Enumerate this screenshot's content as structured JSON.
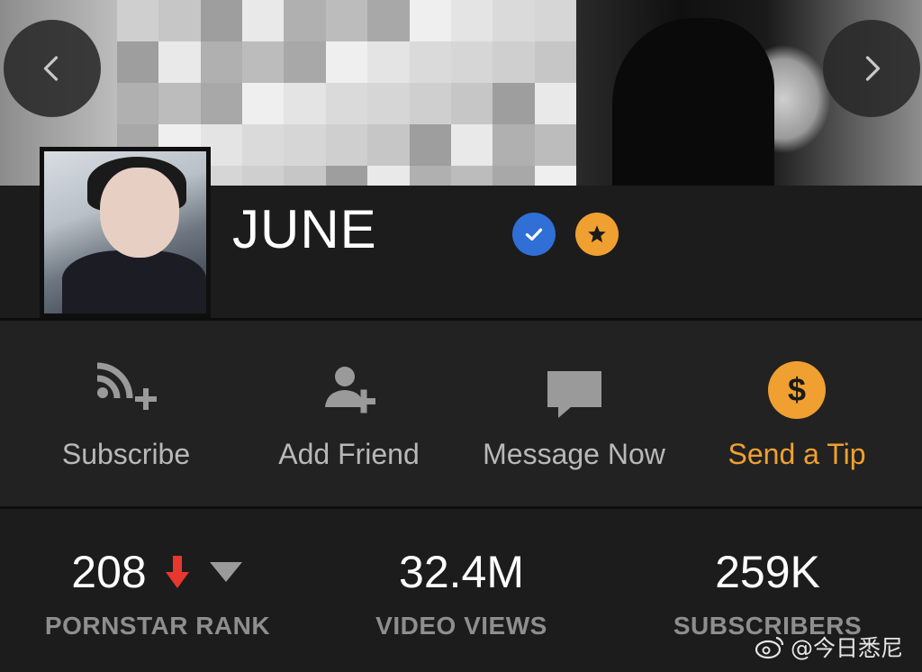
{
  "profile": {
    "name": "JUNE",
    "badges": [
      "verified-icon",
      "star-icon"
    ]
  },
  "nav": {
    "prev_icon": "chevron-left-icon",
    "next_icon": "chevron-right-icon"
  },
  "actions": [
    {
      "label": "Subscribe",
      "icon": "rss-plus-icon",
      "color": "#b8b8b8"
    },
    {
      "label": "Add Friend",
      "icon": "user-plus-icon",
      "color": "#b8b8b8"
    },
    {
      "label": "Message Now",
      "icon": "message-icon",
      "color": "#b8b8b8"
    },
    {
      "label": "Send a Tip",
      "icon": "dollar-icon",
      "color": "#f0a030"
    }
  ],
  "stats": {
    "rank": {
      "value": "208",
      "caption": "PORNSTAR RANK",
      "trend": "down",
      "trend_color": "#e8372d"
    },
    "views": {
      "value": "32.4M",
      "caption": "VIDEO VIEWS"
    },
    "subscribers": {
      "value": "259K",
      "caption": "SUBSCRIBERS"
    }
  },
  "watermark": {
    "text": "@今日悉尼"
  },
  "colors": {
    "accent_orange": "#f0a030",
    "verified_blue": "#2f6fd6",
    "background": "#1c1c1c"
  }
}
